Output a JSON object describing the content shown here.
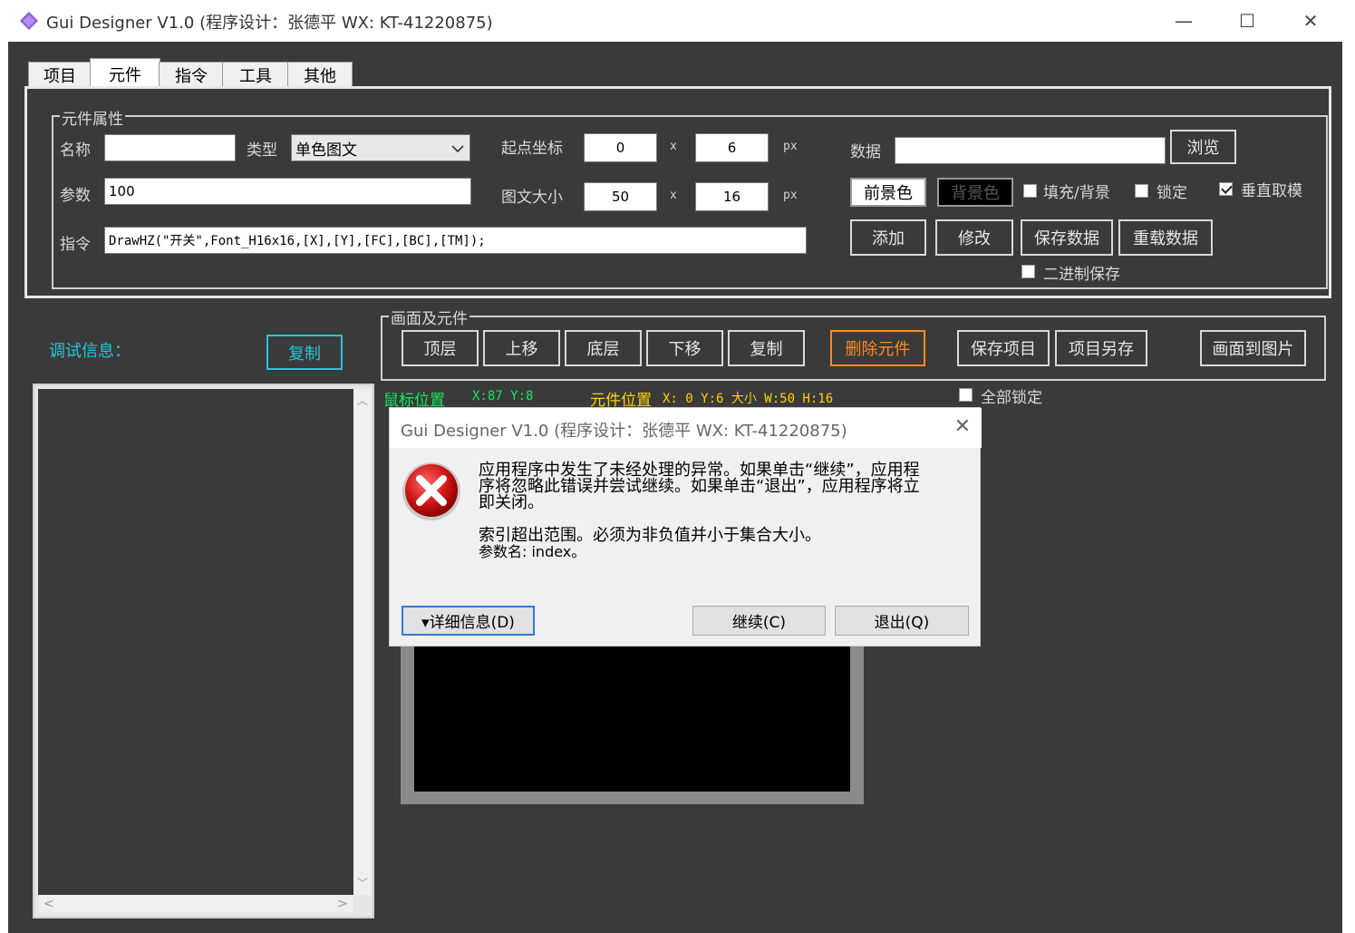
{
  "window": {
    "title": "Gui Designer V1.0  (程序设计：张德平 WX: KT-41220875)",
    "minimize": "—",
    "maximize": "☐",
    "close": "✕"
  },
  "tabs": [
    "项目",
    "元件",
    "指令",
    "工具",
    "其他"
  ],
  "props": {
    "legend": "元件属性",
    "name_label": "名称",
    "name_value": "",
    "type_label": "类型",
    "type_value": "单色图文",
    "param_label": "参数",
    "param_value": "100",
    "cmd_label": "指令",
    "cmd_value": "DrawHZ(\"开关\",Font_H16x16,[X],[Y],[FC],[BC],[TM]);",
    "origin_label": "起点坐标",
    "origin_x": "0",
    "origin_y": "6",
    "size_label": "图文大小",
    "size_w": "50",
    "size_h": "16",
    "x_sep": "x",
    "unit": "px",
    "data_label": "数据",
    "data_value": "",
    "browse": "浏览",
    "fg_color": "前景色",
    "bg_color": "背景色",
    "fill_bg": "填充/背景",
    "lock": "锁定",
    "vertical": "垂直取模",
    "add": "添加",
    "modify": "修改",
    "save_data": "保存数据",
    "reload_data": "重载数据",
    "binary_save": "二进制保存"
  },
  "debug": {
    "label": "调试信息：",
    "copy": "复制"
  },
  "scene": {
    "legend": "画面及元件",
    "top": "顶层",
    "up": "上移",
    "bottom": "底层",
    "down": "下移",
    "copy": "复制",
    "delete": "删除元件",
    "save_project": "保存项目",
    "save_as": "项目另存",
    "to_image": "画面到图片"
  },
  "status": {
    "mouse_label": "鼠标位置",
    "mouse_value": "X:87 Y:8",
    "elem_label": "元件位置",
    "elem_value": "X: 0 Y:6 大小 W:50 H:16",
    "lock_all": "全部锁定"
  },
  "dialog": {
    "title": "Gui Designer V1.0  (程序设计：张德平 WX: KT-41220875)",
    "line1": "应用程序中发生了未经处理的异常。如果单击“继续”，应用程",
    "line2": "序将忽略此错误并尝试继续。如果单击“退出”，应用程序将立",
    "line3": "即关闭。",
    "line4": "索引超出范围。必须为非负值并小于集合大小。",
    "line5": "参数名: index。",
    "details": "▾详细信息(D)",
    "continue": "继续(C)",
    "quit": "退出(Q)",
    "close": "✕"
  },
  "colors": {
    "background": "#3a3a3a",
    "accent_cyan": "#1ec8d8",
    "accent_orange": "#ff8a1e",
    "status_green": "#14e860",
    "status_yellow": "#ffd200"
  }
}
